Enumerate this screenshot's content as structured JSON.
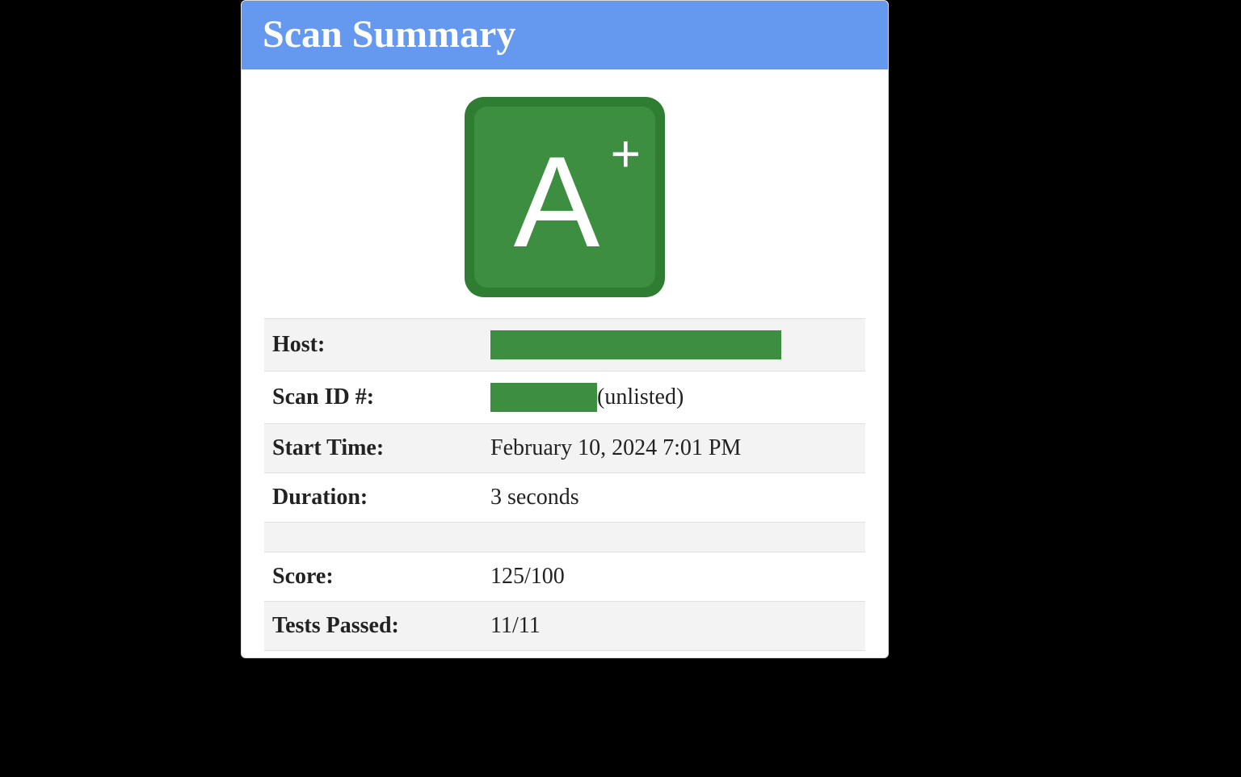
{
  "header": {
    "title": "Scan Summary"
  },
  "grade": {
    "letter": "A",
    "plus": "+"
  },
  "rows": {
    "host_label": "Host:",
    "scanid_label": "Scan ID #:",
    "scanid_note": "(unlisted)",
    "start_label": "Start Time:",
    "start_value": "February 10, 2024 7:01 PM",
    "duration_label": "Duration:",
    "duration_value": "3 seconds",
    "score_label": "Score:",
    "score_value": "125/100",
    "tests_label": "Tests Passed:",
    "tests_value": "11/11"
  }
}
